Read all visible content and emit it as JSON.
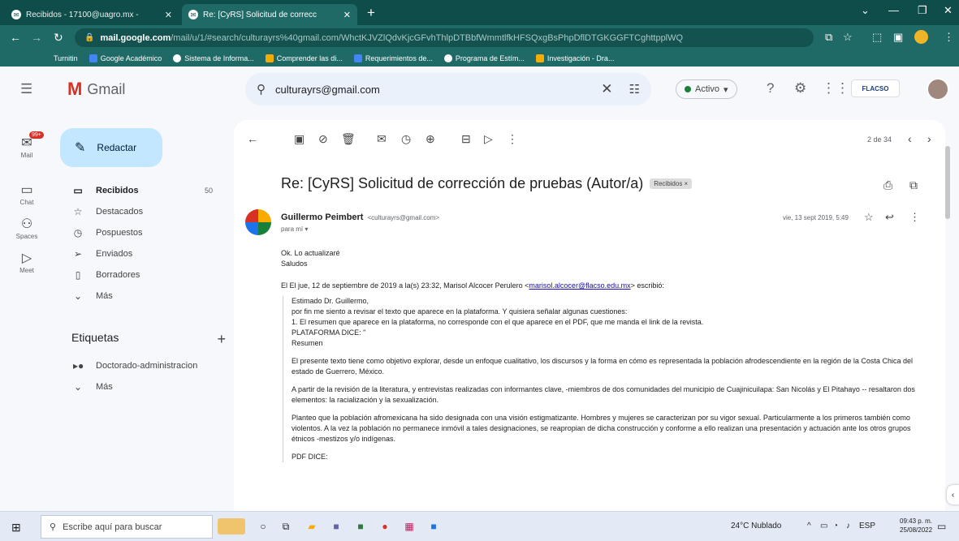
{
  "browser": {
    "tabs": [
      {
        "title": "Recibidos - 17100@uagro.mx - "
      },
      {
        "title": "Re: [CyRS] Solicitud de correcc"
      }
    ],
    "url": {
      "host": "mail.google.com",
      "path": "/mail/u/1/#search/culturayrs%40gmail.com/WhctKJVZlQdvKjcGFvhThlpDTBbfWmmtlfkHFSQxgBsPhpDflDTGKGGFTCghttpplWQ"
    },
    "bookmarks": [
      {
        "label": "Turnitin"
      },
      {
        "label": "Google Académico"
      },
      {
        "label": "Sistema de Informa..."
      },
      {
        "label": "Comprender las di..."
      },
      {
        "label": "Requerimientos de..."
      },
      {
        "label": "Programa de Estím..."
      },
      {
        "label": "Investigación - Dra..."
      }
    ],
    "colors": {
      "chrome_dark": "#0f4d4a",
      "chrome_light": "#1f6a66"
    }
  },
  "gmail": {
    "logo_text": "Gmail",
    "search_value": "culturayrs@gmail.com",
    "status": "Activo",
    "institution_logo": "FLACSO",
    "rail": [
      {
        "label": "Mail",
        "badge": "99+"
      },
      {
        "label": "Chat"
      },
      {
        "label": "Spaces"
      },
      {
        "label": "Meet"
      }
    ],
    "compose_label": "Redactar",
    "nav": [
      {
        "label": "Recibidos",
        "count": "50"
      },
      {
        "label": "Destacados",
        "count": ""
      },
      {
        "label": "Pospuestos",
        "count": ""
      },
      {
        "label": "Enviados",
        "count": ""
      },
      {
        "label": "Borradores",
        "count": ""
      },
      {
        "label": "Más",
        "count": ""
      }
    ],
    "labels_heading": "Etiquetas",
    "labels": [
      {
        "label": "Doctorado-administracion"
      },
      {
        "label": "Más"
      }
    ]
  },
  "message": {
    "pager": "2 de 34",
    "subject": "Re: [CyRS] Solicitud de corrección de pruebas (Autor/a)",
    "label_chip": "Recibidos ×",
    "sender_name": "Guillermo Peimbert",
    "sender_email": "<culturayrs@gmail.com>",
    "to": "para mí ▾",
    "date": "vie, 13 sept 2019, 5:49",
    "body_lines": [
      "Ok. Lo actualizaré",
      "Saludos"
    ],
    "quote_intro_prefix": "El El jue, 12 de septiembre de 2019 a la(s) 23:32, Marisol Alcocer Perulero <",
    "quote_intro_link": "marisol.alcocer@flacso.edu.mx",
    "quote_intro_suffix": "> escribió:",
    "quote_lines": [
      "Estimado Dr. Guillermo,",
      "por fin me siento a revisar el texto que aparece en la plataforma. Y quisiera señalar algunas cuestiones:",
      "1. El resumen que aparece en la plataforma, no corresponde con el que aparece en el PDF, que me manda el link de la revista.",
      "PLATAFORMA DICE: \"",
      "Resumen"
    ],
    "quote_paragraphs": [
      "El presente texto tiene como objetivo explorar, desde un enfoque cualitativo, los discursos y la forma en cómo es representada la población afrodescendiente en la región de la Costa Chica del estado de Guerrero, México.",
      "A partir de la revisión de la literatura, y entrevistas realizadas con informantes clave, -miembros de dos comunidades del municipio de Cuajinicuilapa: San Nicolás y El Pitahayo -- resaltaron dos elementos: la racialización y la sexualización.",
      "Planteo que la población afromexicana ha sido designada con una visión estigmatizante. Hombres y mujeres se caracterizan por su vigor sexual. Particularmente a los primeros también como violentos. A la vez la población no permanece inmóvil a tales designaciones, se reapropian de dicha construcción y conforme a ello realizan una presentación y actuación ante los otros grupos étnicos -mestizos y/o indígenas.",
      "PDF DICE:"
    ]
  },
  "taskbar": {
    "search_placeholder": "Escribe aquí para buscar",
    "weather": "24°C  Nublado",
    "time": "09:43 p. m.",
    "date": "25/08/2022"
  }
}
